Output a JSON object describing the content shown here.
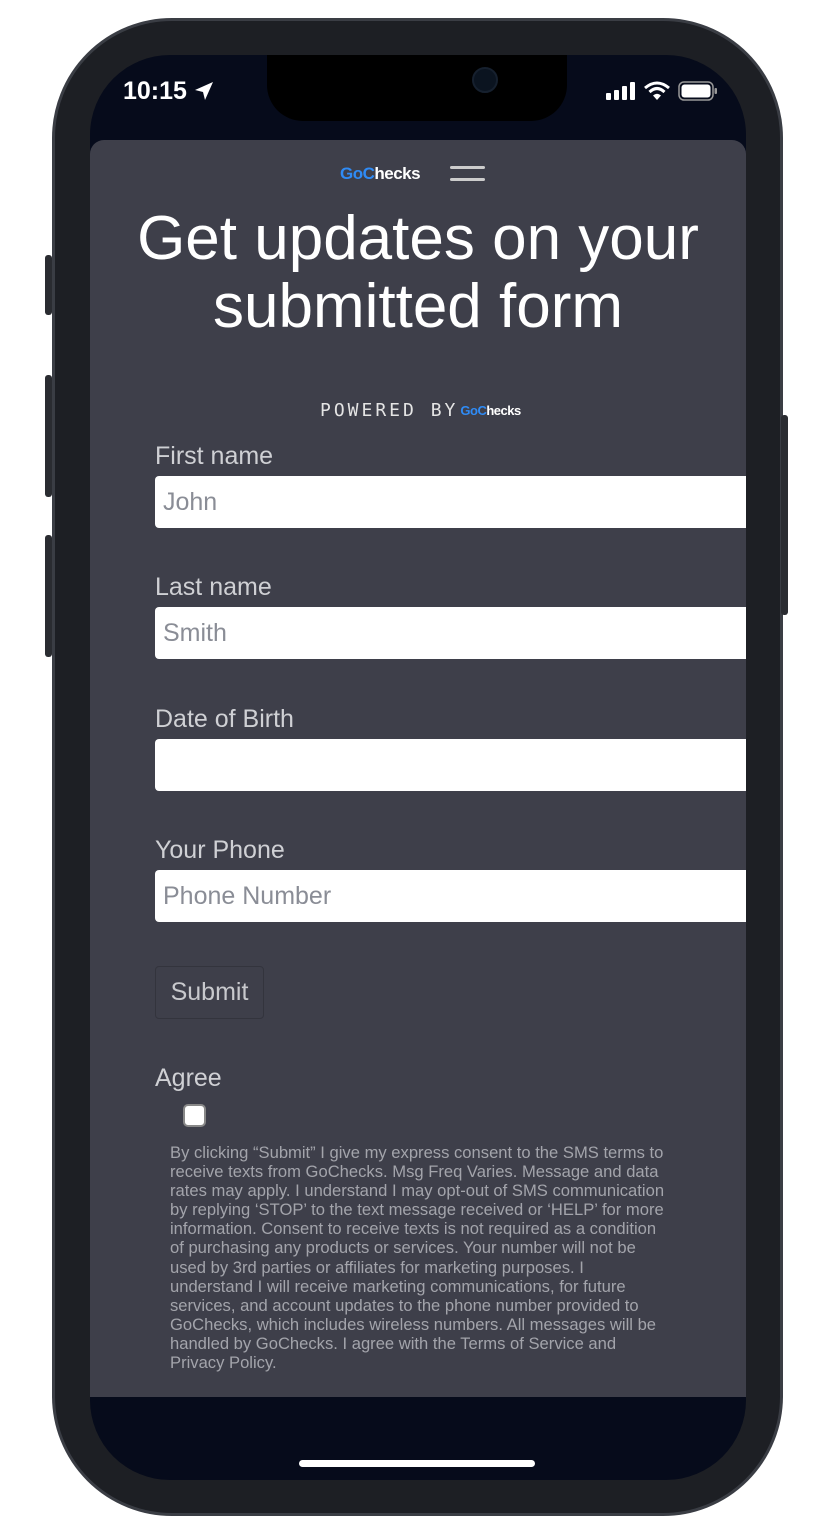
{
  "status_bar": {
    "time": "10:15"
  },
  "header": {
    "logo_go": "Go",
    "logo_c": "C",
    "logo_rest": "hecks"
  },
  "page": {
    "title_line1": "Get updates on your",
    "title_line2": "submitted form",
    "powered_by": "POWERED BY"
  },
  "form": {
    "first_name": {
      "label": "First name",
      "placeholder": "John"
    },
    "last_name": {
      "label": "Last name",
      "placeholder": "Smith"
    },
    "dob": {
      "label": "Date of Birth",
      "placeholder": ""
    },
    "phone": {
      "label": "Your Phone",
      "placeholder": "Phone Number"
    },
    "submit_label": "Submit",
    "agree_label": "Agree",
    "agree_checked": false,
    "legal": "By clicking “Submit” I give my express consent to the SMS terms to receive texts from GoChecks. Msg Freq Varies. Message and data rates may apply. I understand I may opt-out of SMS communication by replying ‘STOP’ to the text message received or ‘HELP’ for more information. Consent to receive texts is not required as a condition of purchasing any products or services. Your number will not be used by 3rd parties or affiliates for marketing purposes. I understand I will receive marketing communications, for future services, and account updates to the phone number provided to GoChecks, which includes wireless numbers. All messages will be handled by GoChecks. I agree with the Terms of Service and Privacy Policy."
  },
  "colors": {
    "brand_blue": "#2f8bf5",
    "card_bg": "#3e3f4a",
    "screen_bg": "#060b1b"
  }
}
